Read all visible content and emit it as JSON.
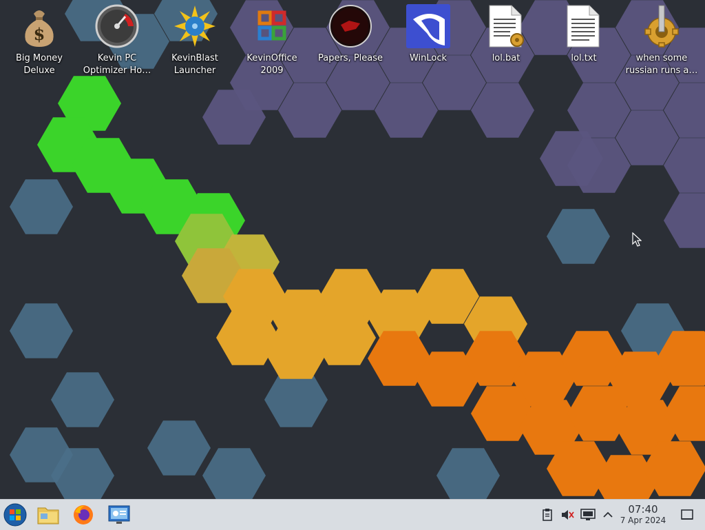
{
  "desktop": {
    "icons": [
      {
        "label": "Big Money\nDeluxe"
      },
      {
        "label": "Kevin PC\nOptimizer Ho…"
      },
      {
        "label": "KevinBlast\nLauncher"
      },
      {
        "label": "KevinOffice\n2009"
      },
      {
        "label": "Papers, Please"
      },
      {
        "label": "WinLock"
      },
      {
        "label": "lol.bat"
      },
      {
        "label": "lol.txt"
      },
      {
        "label": "when some\nrussian runs a…"
      }
    ]
  },
  "taskbar": {
    "clock": {
      "time": "07:40",
      "date": "7 Apr 2024"
    },
    "apps": [
      "start-orb",
      "file-manager",
      "firefox",
      "remote-desktop"
    ],
    "tray": [
      "clipboard",
      "volume-muted",
      "network",
      "expand-tray",
      "show-desktop"
    ]
  },
  "colors": {
    "taskbar": "#d9dde2",
    "desktop_bg": "#2b2f36"
  }
}
